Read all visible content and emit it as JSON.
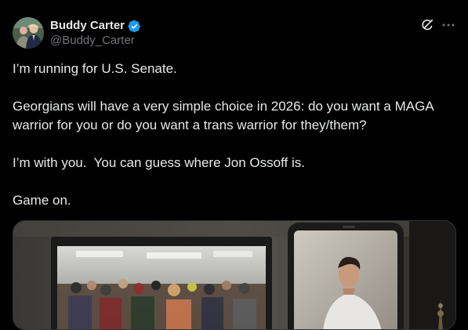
{
  "author": {
    "display_name": "Buddy Carter",
    "handle": "@Buddy_Carter",
    "verified": true,
    "verified_color": "#1d9bf0"
  },
  "header_actions": {
    "grok_icon": "grok-icon",
    "more_icon": "more-icon"
  },
  "tweet": {
    "paragraphs": [
      "I’m running for U.S. Senate.",
      "Georgians will have a very simple choice in 2026: do you want a MAGA warrior for you or do you want a trans warrior for they/them?",
      "I’m with you.  You can guess where Jon Ossoff is.",
      "Game on."
    ]
  },
  "media": {
    "kind": "video-thumbnail"
  },
  "colors": {
    "background": "#000000",
    "primary_text": "#e7e9ea",
    "secondary_text": "#71767b",
    "border": "#2f3336"
  }
}
